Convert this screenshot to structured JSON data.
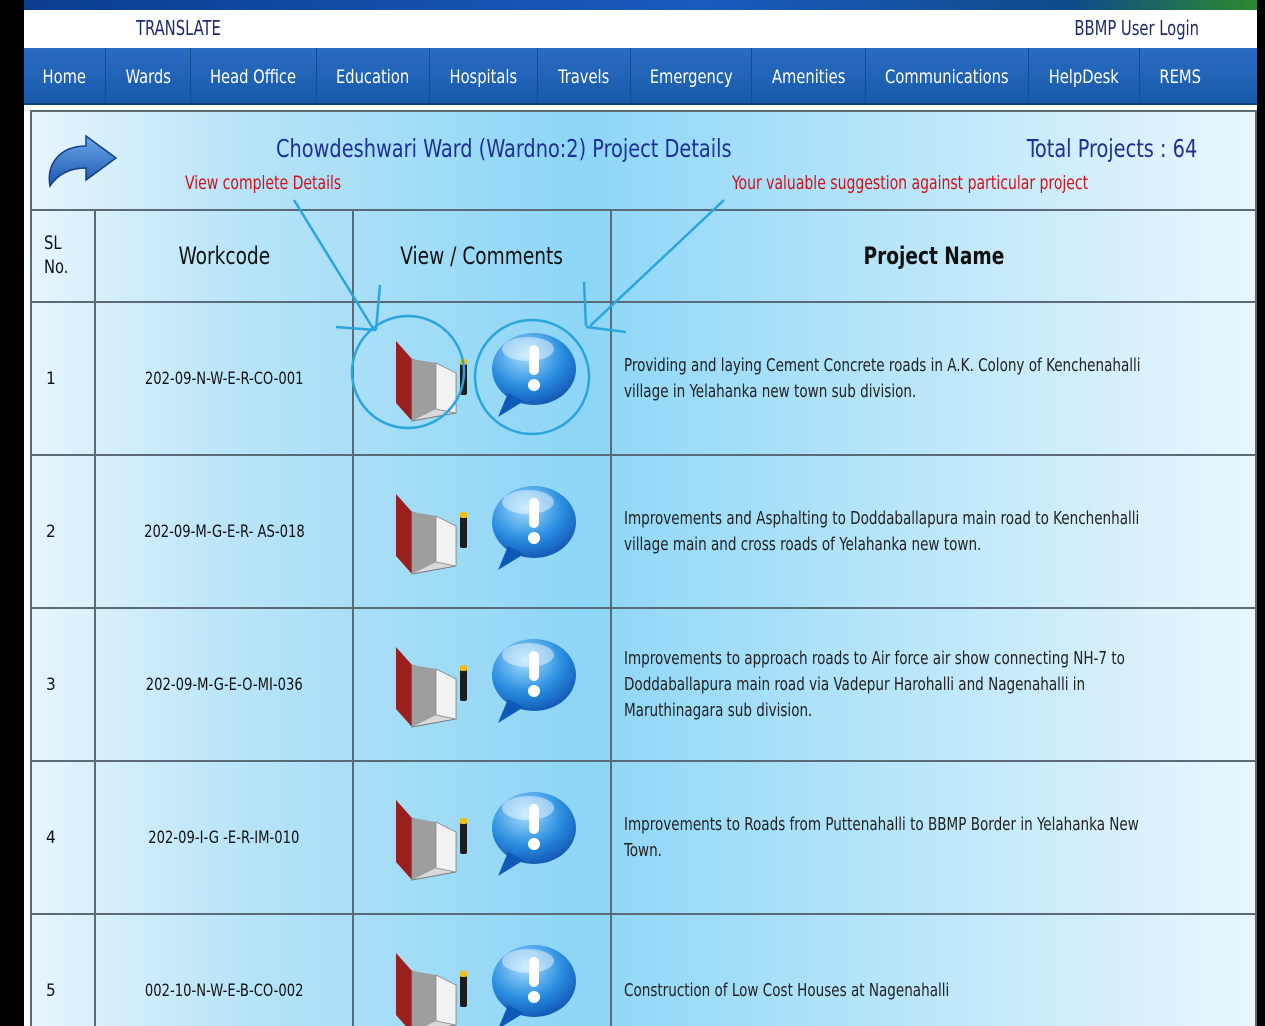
{
  "topbar": {
    "translate": "TRANSLATE",
    "login": "BBMP User Login"
  },
  "nav": [
    {
      "label": "Home"
    },
    {
      "label": "Wards"
    },
    {
      "label": "Head Office"
    },
    {
      "label": "Education"
    },
    {
      "label": "Hospitals"
    },
    {
      "label": "Travels"
    },
    {
      "label": "Emergency"
    },
    {
      "label": "Amenities"
    },
    {
      "label": "Communications"
    },
    {
      "label": "HelpDesk"
    },
    {
      "label": "REMS"
    }
  ],
  "header": {
    "title": "Chowdeshwari Ward (Wardno:2) Project Details",
    "total": "Total Projects : 64",
    "annotation_view": "View complete Details",
    "annotation_suggest": "Your valuable suggestion against particular project"
  },
  "table": {
    "columns": {
      "sl_line1": "SL",
      "sl_line2": "No.",
      "workcode": "Workcode",
      "view": "View / Comments",
      "project": "Project Name"
    },
    "rows": [
      {
        "sl": "1",
        "workcode": "202-09-N-W-E-R-CO-001",
        "project": "Providing and laying Cement Concrete roads in A.K. Colony of Kenchenahalli village in Yelahanka new town sub division."
      },
      {
        "sl": "2",
        "workcode": "202-09-M-G-E-R- AS-018",
        "project": "Improvements and Asphalting to Doddaballapura main road to Kenchenhalli village main and cross roads of Yelahanka new town."
      },
      {
        "sl": "3",
        "workcode": "202-09-M-G-E-O-MI-036",
        "project": "Improvements to approach roads to Air force air show connecting NH-7 to Doddaballapura main road via Vadepur Harohalli and Nagenahalli in Maruthinagara sub division."
      },
      {
        "sl": "4",
        "workcode": "202-09-I-G -E-R-IM-010",
        "project": "Improvements to Roads from Puttenahalli to BBMP Border in Yelahanka New Town."
      },
      {
        "sl": "5",
        "workcode": "002-10-N-W-E-B-CO-002",
        "project": "Construction of Low Cost Houses at Nagenahalli"
      }
    ]
  }
}
